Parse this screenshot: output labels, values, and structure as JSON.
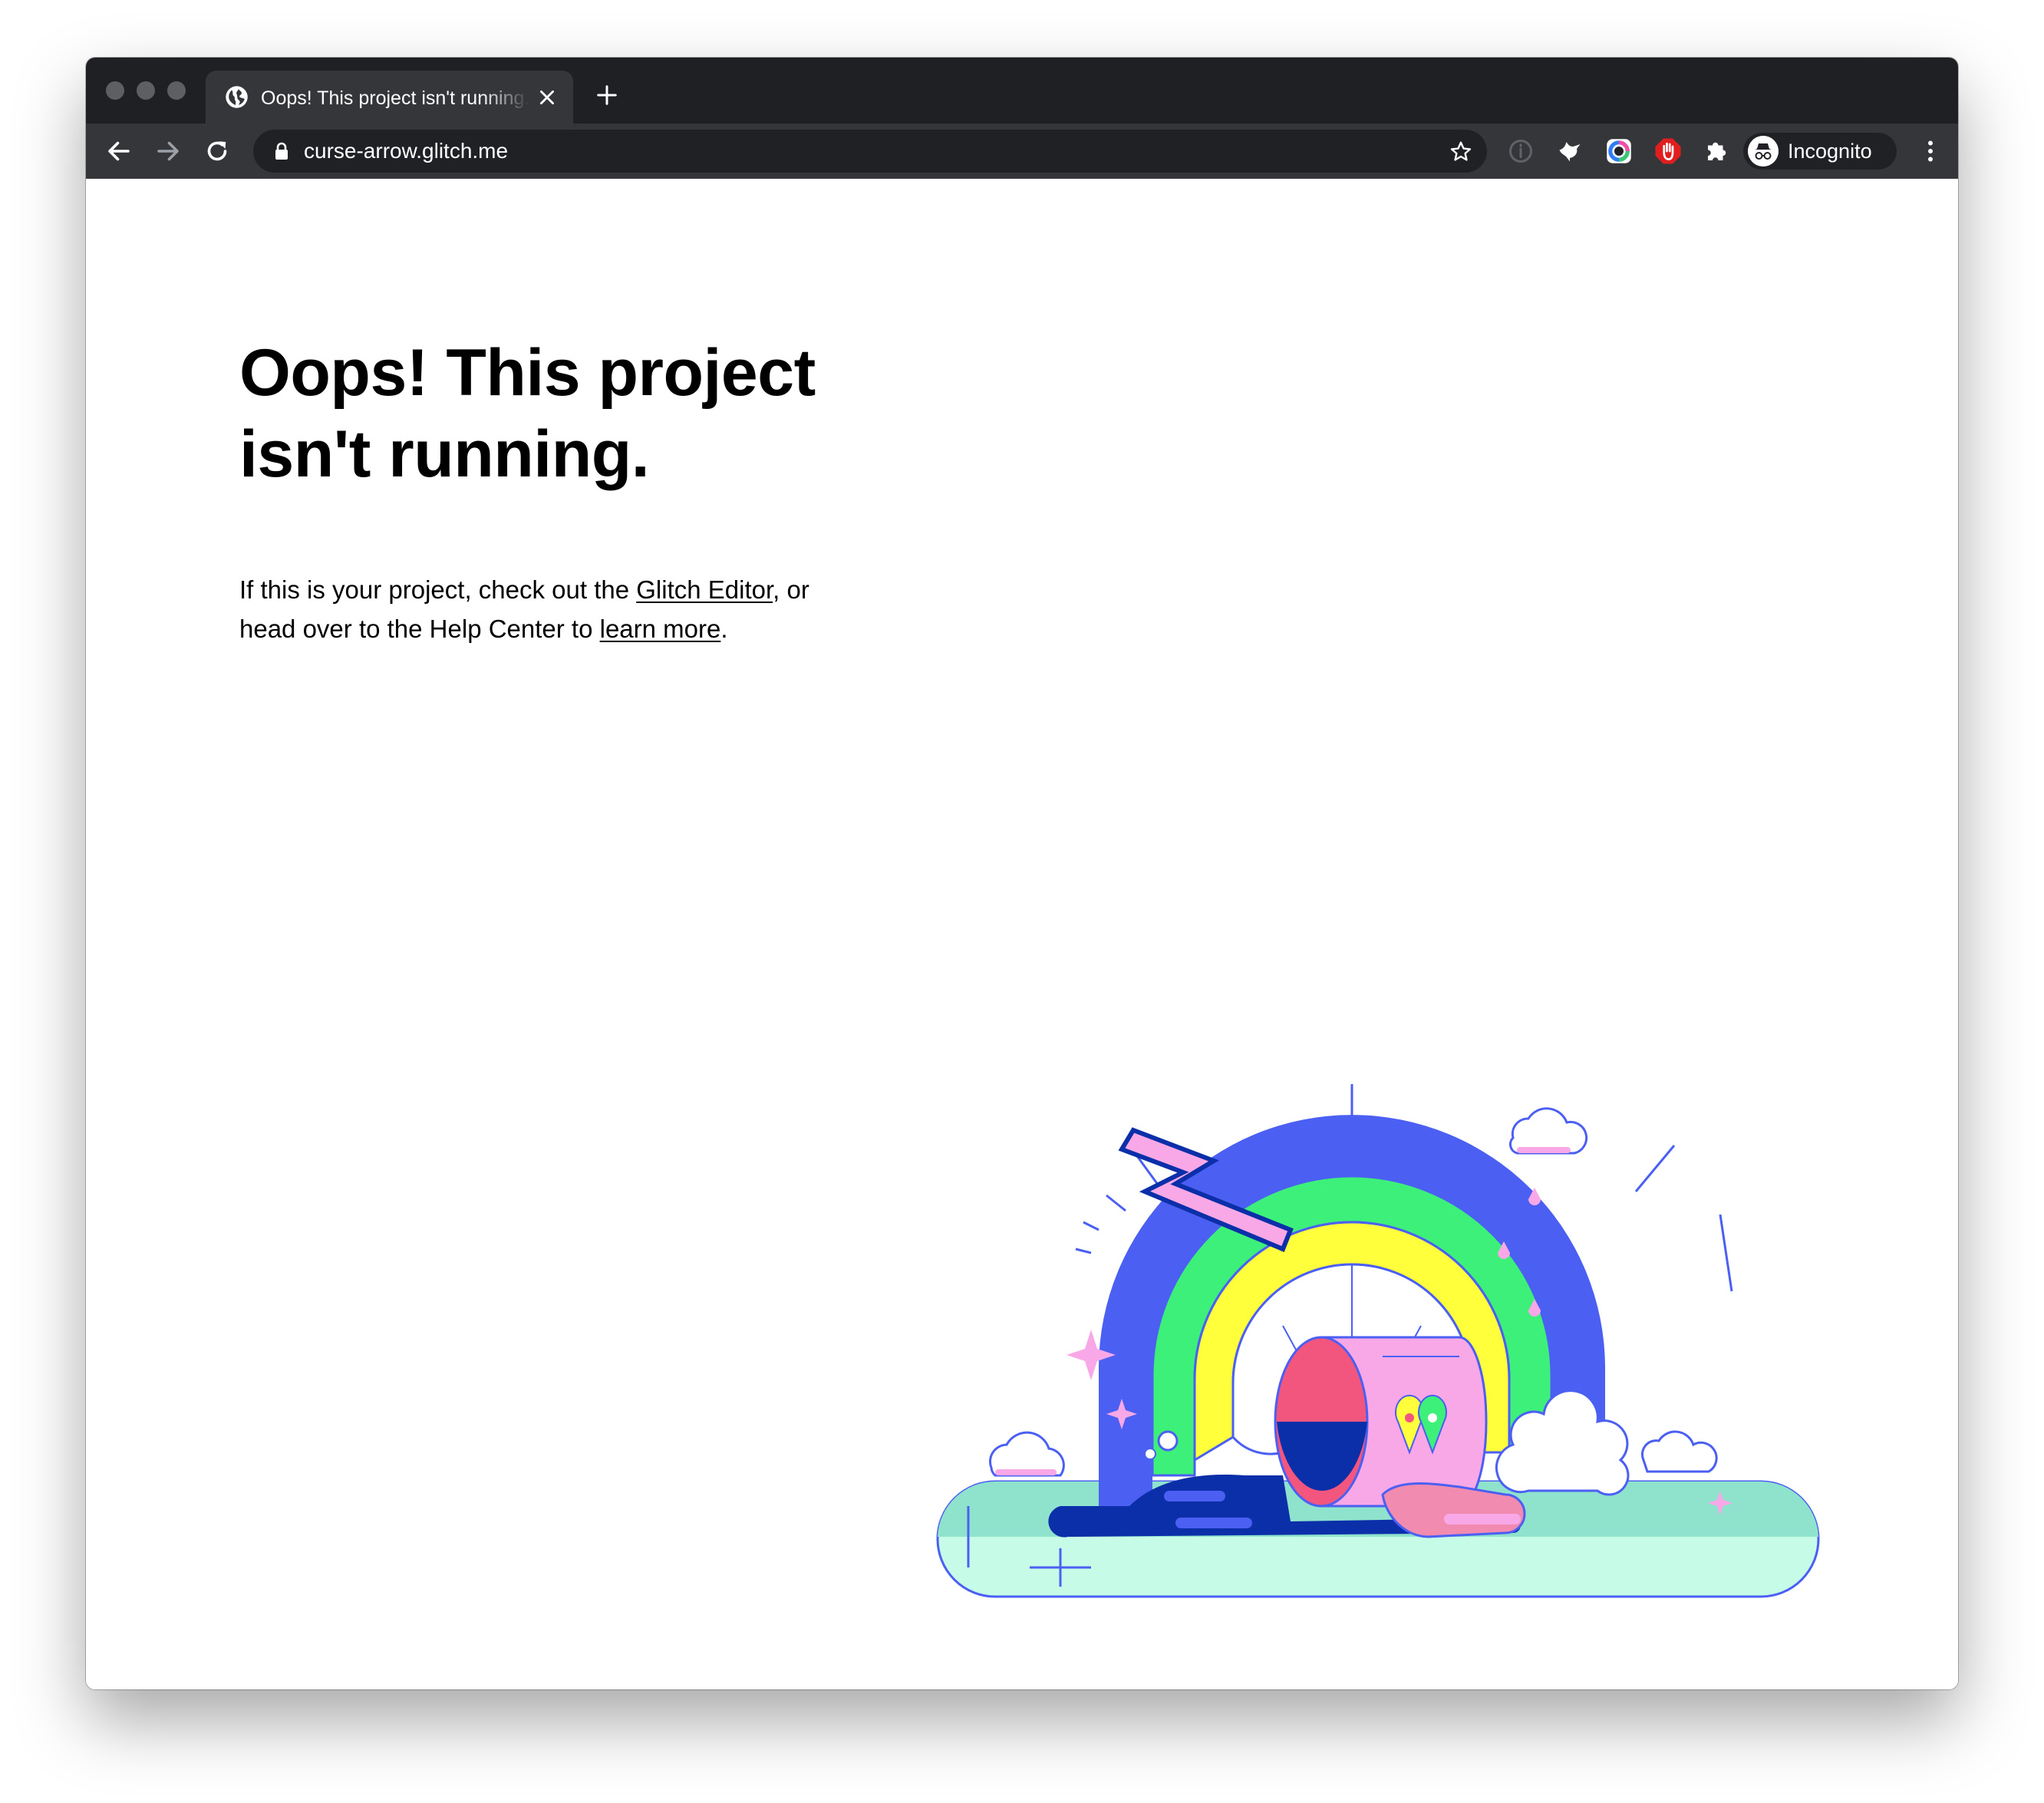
{
  "browser": {
    "tab": {
      "title": "Oops! This project isn't running.",
      "favicon": "globe-icon",
      "close_icon": "close-icon"
    },
    "new_tab_icon": "plus-icon",
    "toolbar": {
      "back_icon": "arrow-left-icon",
      "forward_icon": "arrow-right-icon",
      "reload_icon": "reload-icon",
      "lock_icon": "lock-icon",
      "url": "curse-arrow.glitch.me",
      "bookmark_icon": "star-icon",
      "extensions": [
        "info-icon",
        "bird-icon",
        "color-ring-icon",
        "stop-hand-icon",
        "puzzle-icon"
      ],
      "profile_label": "Incognito",
      "profile_icon": "incognito-icon",
      "menu_icon": "kebab-menu-icon"
    },
    "colors": {
      "tabstrip": "#1f2023",
      "active_tab": "#35363a",
      "omnibox": "#202124"
    }
  },
  "page": {
    "heading": "Oops! This project isn't running.",
    "body": {
      "text_1": "If this is your project, check out the ",
      "link_1": "Glitch Editor",
      "text_2": ", or head over to the Help Center to ",
      "link_2": "learn more",
      "text_3": "."
    },
    "illustration": "broken-rainbow-illustration",
    "palette": {
      "blue": "#4b5ff2",
      "green": "#3cf07a",
      "yellow": "#ffff3c",
      "pink": "#f8a8e6",
      "navy": "#0a2fa8",
      "mint": "#c6fbe8",
      "red": "#f2557e"
    }
  }
}
